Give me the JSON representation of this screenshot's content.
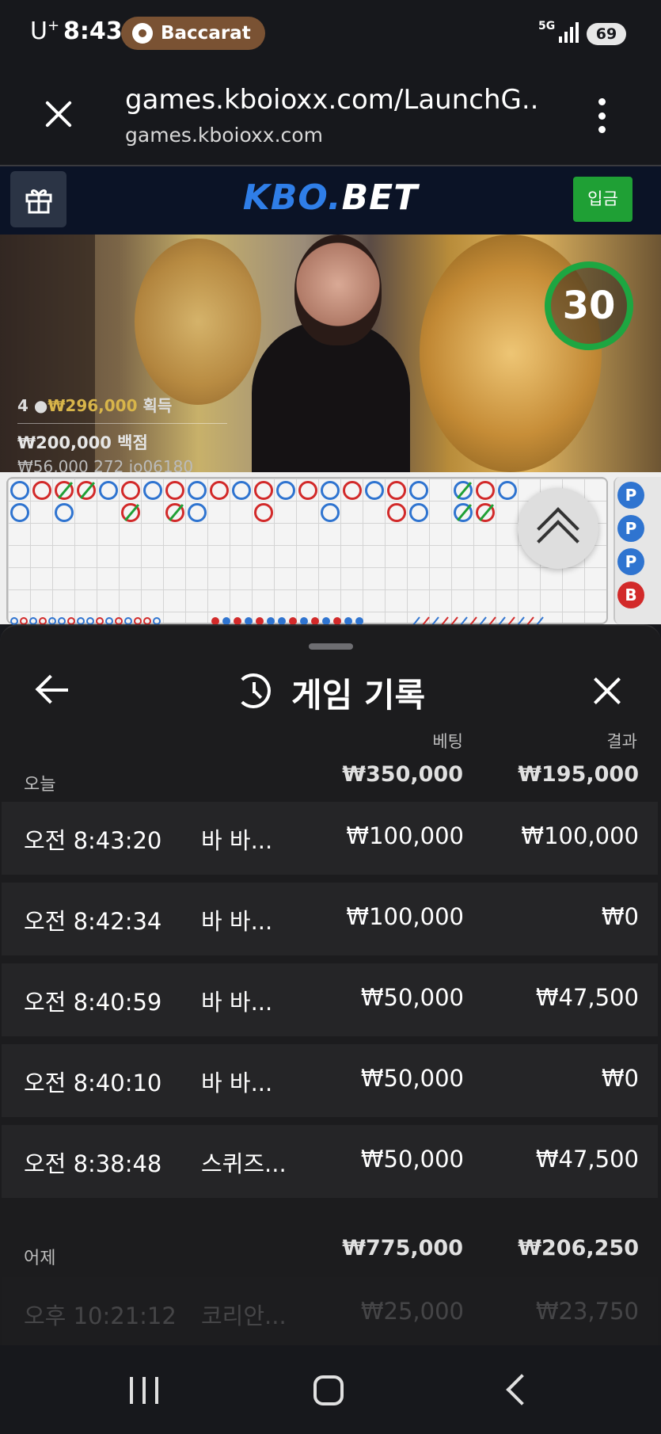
{
  "status_bar": {
    "carrier": "U",
    "carrier_sup": "+",
    "time": "8:43",
    "app_chip": "Baccarat",
    "network": "5G",
    "battery": "69"
  },
  "browser": {
    "url_title": "games.kboioxx.com/LaunchG...",
    "url_domain": "games.kboioxx.com"
  },
  "site": {
    "logo_part1": "KBO",
    "logo_dot": ".",
    "logo_part2": "BET",
    "deposit_label": "입금",
    "accent": "#2f7ee8",
    "deposit_color": "#1fa035"
  },
  "video": {
    "timer": "30",
    "players": "4",
    "win_amount": "₩296,000",
    "win_label": "획득",
    "stat2_amount": "₩200,000",
    "stat2_label": "백점",
    "stat3": "₩56,000 272 jo06180"
  },
  "scoreboard": {
    "side_markers": [
      "P",
      "P",
      "P",
      "B"
    ]
  },
  "sheet": {
    "title": "게임 기록",
    "col_bet": "베팅",
    "col_result": "결과",
    "today": {
      "label": "오늘",
      "bet_total": "₩350,000",
      "result_total": "₩195,000"
    },
    "rows": [
      {
        "time": "오전 8:43:20",
        "game": "바 바...",
        "bet": "₩100,000",
        "result": "₩100,000"
      },
      {
        "time": "오전 8:42:34",
        "game": "바 바...",
        "bet": "₩100,000",
        "result": "₩0"
      },
      {
        "time": "오전 8:40:59",
        "game": "바 바...",
        "bet": "₩50,000",
        "result": "₩47,500"
      },
      {
        "time": "오전 8:40:10",
        "game": "바 바...",
        "bet": "₩50,000",
        "result": "₩0"
      },
      {
        "time": "오전 8:38:48",
        "game": "스퀴즈...",
        "bet": "₩50,000",
        "result": "₩47,500"
      }
    ],
    "yesterday": {
      "label": "어제",
      "bet_total": "₩775,000",
      "result_total": "₩206,250"
    },
    "partial_row": {
      "time": "오후 10:21:12",
      "game": "코리안...",
      "bet": "₩25,000",
      "result": "₩23,750"
    }
  }
}
